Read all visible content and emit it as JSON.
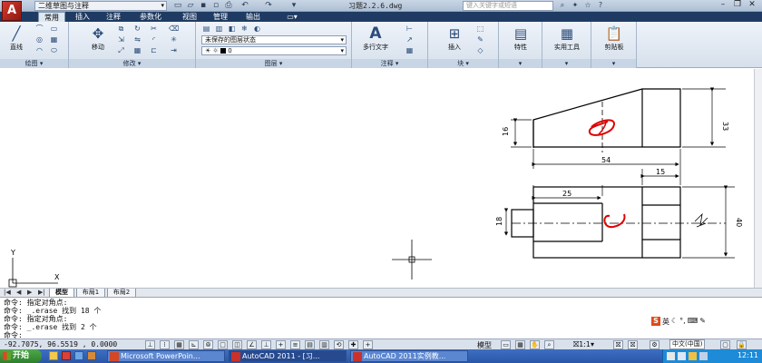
{
  "app": {
    "logo_letter": "A",
    "workspace": "二维草图与注释",
    "doc_title": "习题2.2.6.dwg",
    "search_placeholder": "键入关键字或短语"
  },
  "tabs": [
    "常用",
    "插入",
    "注释",
    "参数化",
    "视图",
    "管理",
    "输出"
  ],
  "ribbon": {
    "draw_panel": "绘图",
    "draw_line": "直线",
    "modify_panel": "修改",
    "modify_move": "移动",
    "layers_panel": "图层",
    "layer_state": "未保存的图层状态",
    "current_layer": "0",
    "annotation_panel": "注释",
    "multiline_text": "多行文字",
    "block_panel": "块",
    "insert": "插入",
    "properties": "特性",
    "utilities": "实用工具",
    "clipboard": "剪贴板"
  },
  "drawing": {
    "dims": {
      "d16": "16",
      "d33": "33",
      "d54": "54",
      "d15": "15",
      "d25": "25",
      "d18": "18",
      "d40": "40"
    },
    "ucs_y": "Y",
    "ucs_x": "X"
  },
  "layout_tabs": [
    "模型",
    "布局1",
    "布局2"
  ],
  "command_lines": [
    "命令: 指定对角点:",
    "命令: _.erase 找到 18 个",
    "命令: 指定对角点:",
    "命令: _.erase 找到 2 个",
    "命令:"
  ],
  "ime": {
    "lang": "英"
  },
  "statusbar": {
    "coords": "-92.7075, 96.5519 , 0.0000",
    "model": "模型",
    "scale": "1:1",
    "ime_lang": "中文(中国)"
  },
  "taskbar": {
    "start": "开始",
    "tasks": [
      "Microsoft PowerPoin...",
      "AutoCAD 2011 - [习...",
      "AutoCAD 2011实例教..."
    ],
    "clock": "12:11"
  },
  "colors": {
    "accent": "#1f3b63",
    "markup_red": "#e00000",
    "logo": "#d83a2f"
  }
}
